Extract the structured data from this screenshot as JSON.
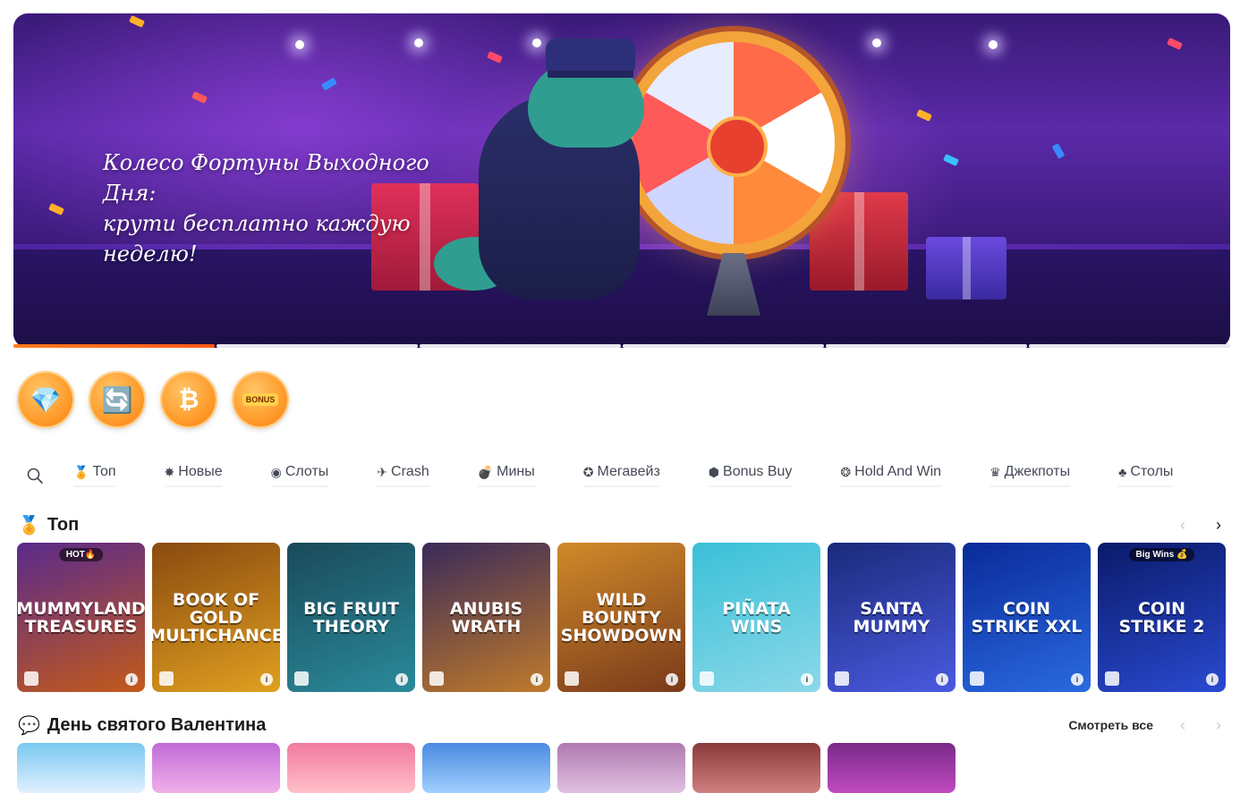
{
  "banner": {
    "title_line1": "Колесо Фортуны Выходного Дня:",
    "title_line2": "крути бесплатно каждую неделю!"
  },
  "progress": {
    "segments": 6,
    "active_index": 0,
    "active_fraction": 1.0
  },
  "promos": [
    {
      "icon": "gem-chest-icon",
      "glyph": "💎"
    },
    {
      "icon": "refresh-gift-icon",
      "glyph": "🔄"
    },
    {
      "icon": "bitcoin-icon",
      "glyph": "₿"
    },
    {
      "icon": "bonus-gift-icon",
      "label": "BONUS"
    }
  ],
  "categories": [
    {
      "icon": "medal-icon",
      "glyph": "🏅",
      "label": "Топ"
    },
    {
      "icon": "star-burst-icon",
      "glyph": "✸",
      "label": "Новые"
    },
    {
      "icon": "slots-icon",
      "glyph": "◉",
      "label": "Слоты"
    },
    {
      "icon": "crash-icon",
      "glyph": "✈",
      "label": "Crash"
    },
    {
      "icon": "bomb-icon",
      "glyph": "💣",
      "label": "Мины"
    },
    {
      "icon": "megaways-icon",
      "glyph": "✪",
      "label": "Мегавейз"
    },
    {
      "icon": "bonus-buy-icon",
      "glyph": "⬢",
      "label": "Bonus Buy"
    },
    {
      "icon": "hold-win-icon",
      "glyph": "❂",
      "label": "Hold And Win"
    },
    {
      "icon": "crown-icon",
      "glyph": "♛",
      "label": "Джекпоты"
    },
    {
      "icon": "table-games-icon",
      "glyph": "♣",
      "label": "Столы"
    }
  ],
  "top_section": {
    "icon": "medal-icon",
    "title": "Топ",
    "games": [
      {
        "name": "MUMMYLAND TREASURES",
        "badge": "HOT🔥",
        "bg1": "#5a2a8c",
        "bg2": "#c35a1a"
      },
      {
        "name": "BOOK of GOLD MULTICHANCE",
        "badge": "",
        "bg1": "#8a4a10",
        "bg2": "#e0a020"
      },
      {
        "name": "BIG FRUIT THEORY",
        "badge": "",
        "bg1": "#1a4a5a",
        "bg2": "#2a8a9a"
      },
      {
        "name": "ANUBIS WRATH",
        "badge": "",
        "bg1": "#3a2a5a",
        "bg2": "#c07a2a"
      },
      {
        "name": "WILD BOUNTY SHOWDOWN",
        "badge": "",
        "bg1": "#d08a2a",
        "bg2": "#7a3a1a"
      },
      {
        "name": "Piñata WINS",
        "badge": "",
        "bg1": "#3ac0d8",
        "bg2": "#8ad8e8"
      },
      {
        "name": "SANTA MUMMY",
        "badge": "",
        "bg1": "#1a2a7a",
        "bg2": "#4a5ae0"
      },
      {
        "name": "COIN STRIKE XXL",
        "badge": "",
        "bg1": "#0a2a9a",
        "bg2": "#2a6ae0"
      },
      {
        "name": "COIN STRIKE 2",
        "badge": "Big Wins 💰",
        "bg1": "#0a1a6a",
        "bg2": "#2a4ad0"
      }
    ]
  },
  "valentine_section": {
    "icon": "chat-heart-icon",
    "title": "День святого Валентина",
    "see_all": "Смотреть все",
    "games": [
      {
        "bg1": "#7ac8f0",
        "bg2": "#e0f0ff"
      },
      {
        "bg1": "#c06ad8",
        "bg2": "#f0b0e8"
      },
      {
        "bg1": "#f07aa0",
        "bg2": "#ffc0c8"
      },
      {
        "bg1": "#4a8ae0",
        "bg2": "#a0d0ff"
      },
      {
        "bg1": "#b07ab0",
        "bg2": "#e0c0e0"
      },
      {
        "bg1": "#8a3a3a",
        "bg2": "#d08080"
      },
      {
        "bg1": "#7a2a8a",
        "bg2": "#c04ac0"
      }
    ]
  },
  "colors": {
    "accent": "#ff6a1a",
    "promo": "#ff9a2a"
  }
}
